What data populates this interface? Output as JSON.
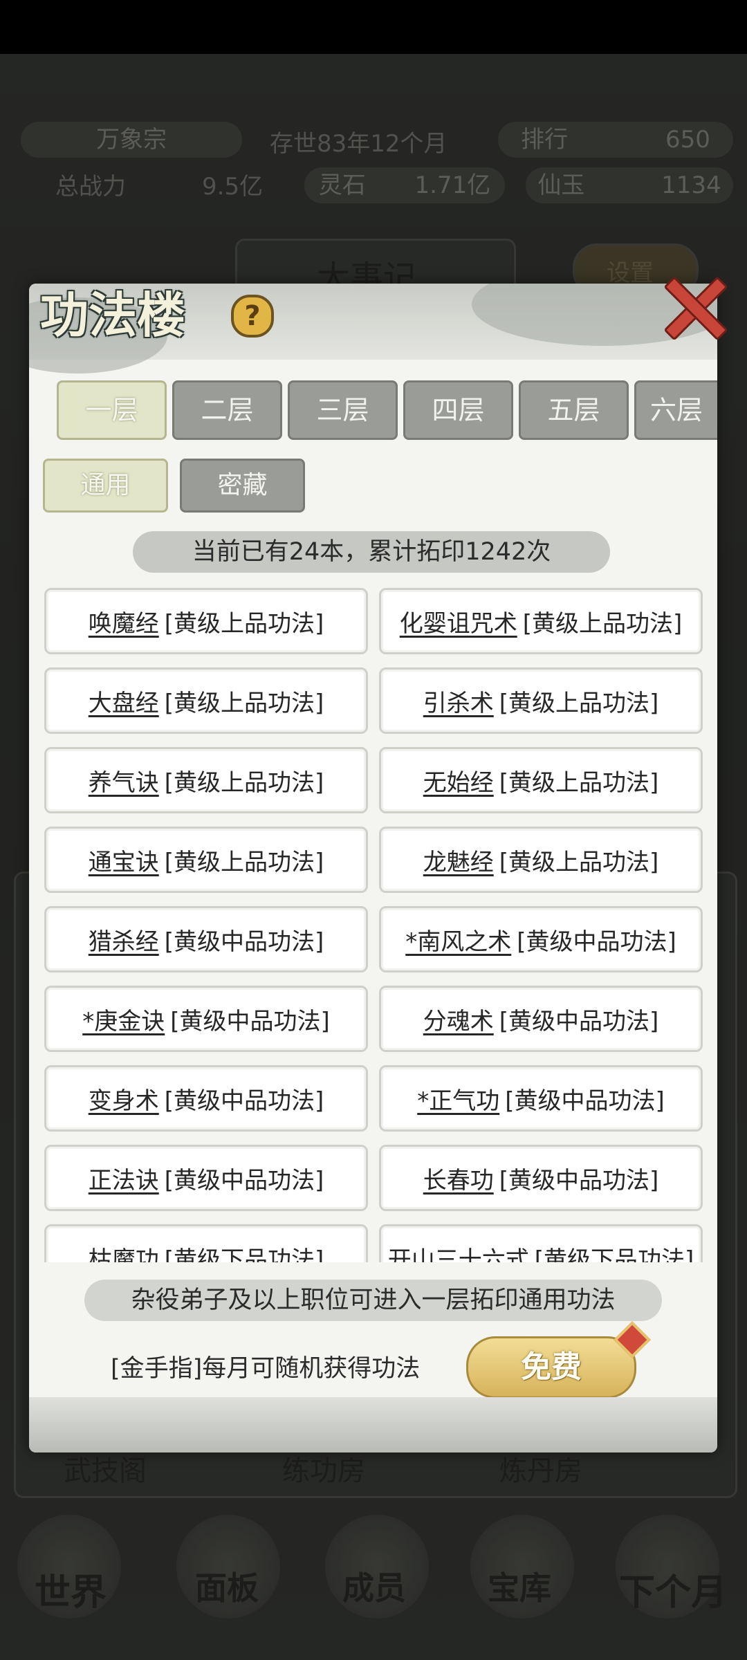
{
  "background": {
    "sect_name": "万象宗",
    "era": "存世83年12个月",
    "rank_label": "排行",
    "rank_value": "650",
    "power_label": "总战力",
    "power_value": "9.5亿",
    "stone_label": "灵石",
    "stone_value": "1.71亿",
    "jade_label": "仙玉",
    "jade_value": "1134",
    "events_title": "大事记",
    "settings_label": "设置",
    "buildings": [
      "武技阁",
      "练功房",
      "炼丹房"
    ],
    "nav": [
      "世界",
      "面板",
      "成员",
      "宝库",
      "下个月"
    ]
  },
  "dialog": {
    "title": "功法楼",
    "help_icon": "question-icon",
    "close_icon": "close-icon",
    "floors": [
      "一层",
      "二层",
      "三层",
      "四层",
      "五层",
      "六层"
    ],
    "active_floor": "一层",
    "categories": [
      "通用",
      "密藏"
    ],
    "active_category": "通用",
    "summary": "当前已有24本，累计拓印1242次",
    "books": [
      {
        "name": "唤魔经",
        "grade": "[黄级上品功法]"
      },
      {
        "name": "化婴诅咒术",
        "grade": "[黄级上品功法]"
      },
      {
        "name": "大盘经",
        "grade": "[黄级上品功法]"
      },
      {
        "name": "引杀术",
        "grade": "[黄级上品功法]"
      },
      {
        "name": "养气诀",
        "grade": "[黄级上品功法]"
      },
      {
        "name": "无始经",
        "grade": "[黄级上品功法]"
      },
      {
        "name": "通宝诀",
        "grade": "[黄级上品功法]"
      },
      {
        "name": "龙魅经",
        "grade": "[黄级上品功法]"
      },
      {
        "name": "猎杀经",
        "grade": "[黄级中品功法]"
      },
      {
        "name": "*南风之术",
        "grade": "[黄级中品功法]"
      },
      {
        "name": "*庚金诀",
        "grade": "[黄级中品功法]"
      },
      {
        "name": "分魂术",
        "grade": "[黄级中品功法]"
      },
      {
        "name": "变身术",
        "grade": "[黄级中品功法]"
      },
      {
        "name": "*正气功",
        "grade": "[黄级中品功法]"
      },
      {
        "name": "正法诀",
        "grade": "[黄级中品功法]"
      },
      {
        "name": "长春功",
        "grade": "[黄级中品功法]"
      },
      {
        "name": "枯魔功",
        "grade": "[黄级下品功法]"
      },
      {
        "name": "开山三十六式",
        "grade": "[黄级下品功法]"
      }
    ],
    "footer_note": "杂役弟子及以上职位可进入一层拓印通用功法",
    "golden_finger_text": "[金手指]每月可随机获得功法",
    "free_button": "免费"
  },
  "colors": {
    "accent_gold": "#e2b646",
    "active_tab": "#e2e5c8",
    "inactive_tab": "#9a9c97",
    "close_red": "#c8453a"
  }
}
